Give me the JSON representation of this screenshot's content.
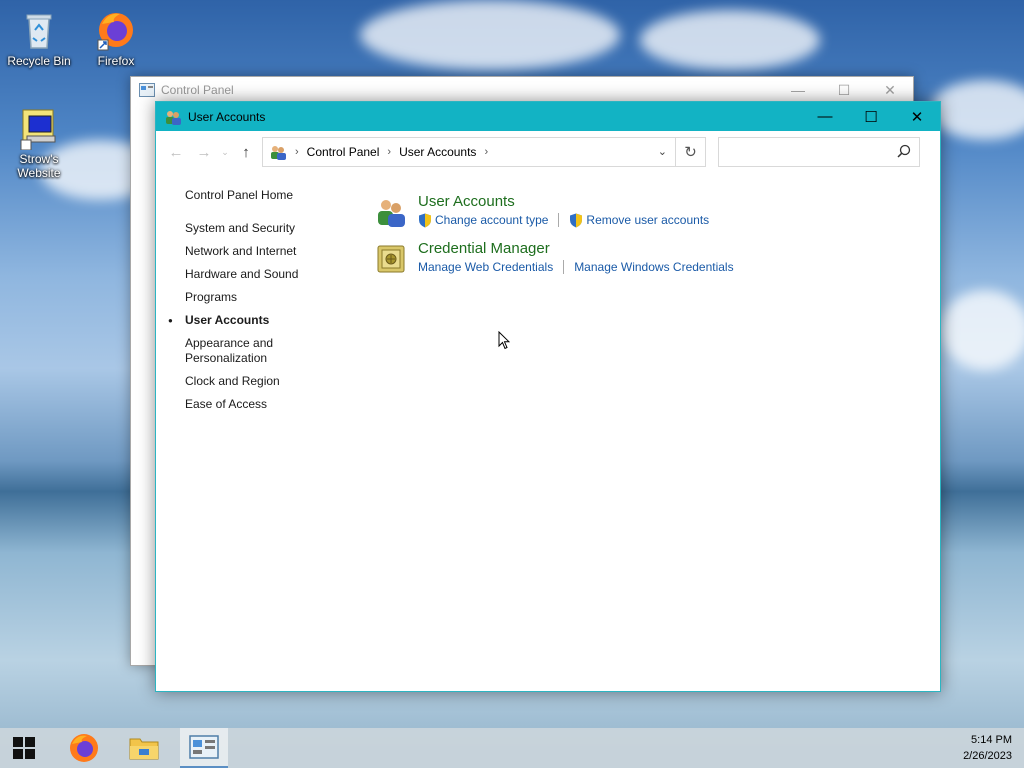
{
  "desktop": {
    "icons": [
      {
        "label": "Recycle Bin"
      },
      {
        "label": "Firefox"
      },
      {
        "label": "Strow's Website"
      }
    ]
  },
  "back_window": {
    "title": "Control Panel"
  },
  "window": {
    "title": "User Accounts",
    "address": {
      "crumbs": [
        "Control Panel",
        "User Accounts"
      ]
    },
    "search": {
      "placeholder": ""
    },
    "sidebar": {
      "home": "Control Panel Home",
      "items": [
        "System and Security",
        "Network and Internet",
        "Hardware and Sound",
        "Programs",
        "User Accounts",
        "Appearance and Personalization",
        "Clock and Region",
        "Ease of Access"
      ],
      "active_index": 4
    },
    "categories": [
      {
        "heading": "User Accounts",
        "links": [
          "Change account type",
          "Remove user accounts"
        ]
      },
      {
        "heading": "Credential Manager",
        "links": [
          "Manage Web Credentials",
          "Manage Windows Credentials"
        ]
      }
    ]
  },
  "taskbar": {
    "time": "5:14 PM",
    "date": "2/26/2023"
  },
  "colors": {
    "titlebar_accent": "#12b3c4",
    "category_heading": "#1e6e1e",
    "link": "#1a5aa7"
  }
}
